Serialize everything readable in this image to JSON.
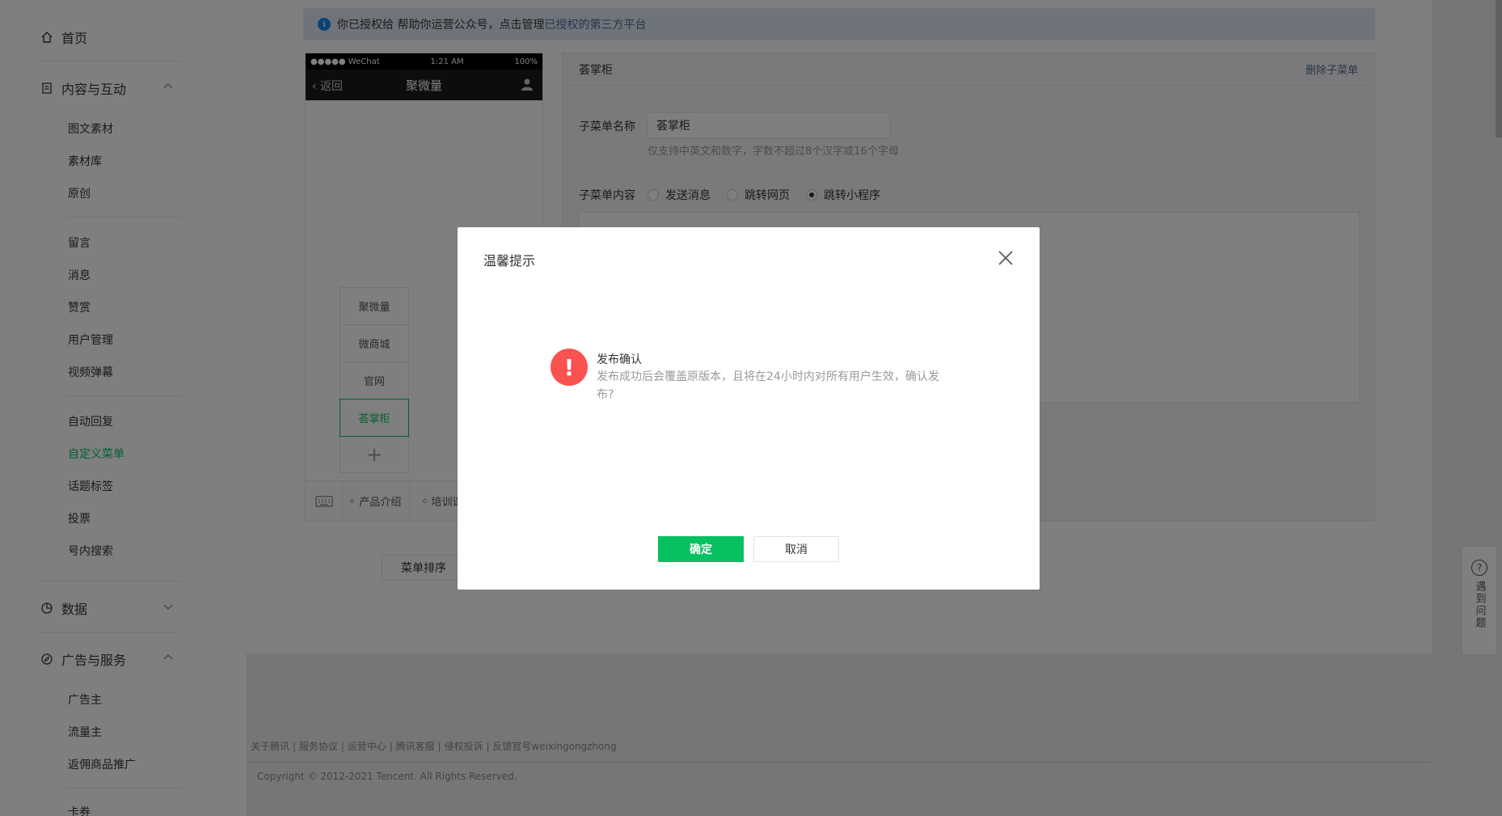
{
  "sidebar": {
    "home": "首页",
    "content_section": "内容与互动",
    "content_items": [
      "图文素材",
      "素材库",
      "原创"
    ],
    "interaction_items": [
      "留言",
      "消息",
      "赞赏",
      "用户管理",
      "视频弹幕"
    ],
    "feature_items": [
      "自动回复",
      "自定义菜单",
      "话题标签",
      "投票",
      "号内搜索"
    ],
    "data_section": "数据",
    "ads_section": "广告与服务",
    "ads_items": [
      "广告主",
      "流量主",
      "返佣商品推广"
    ],
    "more_item": "卡券"
  },
  "notice": {
    "text": "你已授权给   帮助你运营公众号，点击管理",
    "link": "已授权的第三方平台"
  },
  "phone": {
    "carrier": "●●●●● WeChat",
    "time": "1:21 AM",
    "battery": "100%",
    "back": "返回",
    "title": "聚微量",
    "sub_items": [
      "聚微量",
      "微商城",
      "官网",
      "荟掌柜"
    ],
    "add": "+",
    "bottom_menus": [
      "产品介绍",
      "培训课"
    ]
  },
  "sort_button": "菜单排序",
  "editor": {
    "title": "荟掌柜",
    "delete": "删除子菜单",
    "name_label": "子菜单名称",
    "name_value": "荟掌柜",
    "name_hint": "仅支持中英文和数字，字数不超过8个汉字或16个字母",
    "content_label": "子菜单内容",
    "options": [
      "发送消息",
      "跳转网页",
      "跳转小程序"
    ],
    "selected_option": "跳转小程序"
  },
  "footer": {
    "links": [
      "关于腾讯",
      "服务协议",
      "运营中心",
      "腾讯客服",
      "侵权投诉",
      "反馈官号weixingongzhong"
    ],
    "copyright": "Copyright © 2012-2021 Tencent. All Rights Reserved."
  },
  "help": {
    "label": "遇到问题"
  },
  "dialog": {
    "title": "温馨提示",
    "msg_title": "发布确认",
    "msg_desc": "发布成功后会覆盖原版本，且将在24小时内对所有用户生效，确认发布?",
    "ok": "确定",
    "cancel": "取消"
  },
  "colors": {
    "accent": "#07c160",
    "danger": "#fa5151",
    "link": "#576b95"
  }
}
